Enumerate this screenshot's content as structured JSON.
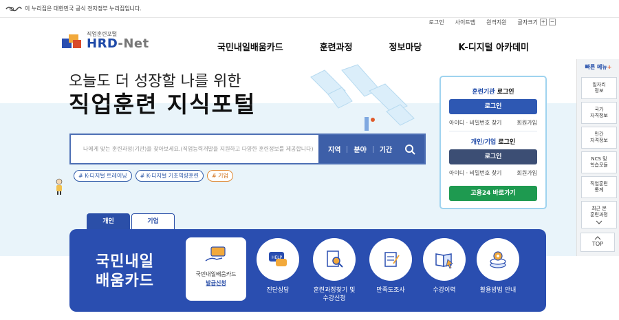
{
  "gov_bar": {
    "text": "이 누리집은 대한민국 공식 전자정부 누리집입니다."
  },
  "util": {
    "login": "로그인",
    "sitemap": "사이트맵",
    "remote": "원격지원",
    "fontsize": "글자크기",
    "plus": "+",
    "minus": "−"
  },
  "logo": {
    "sub": "직업훈련포털",
    "main_a": "HRD",
    "main_b": "-Net"
  },
  "gnb": [
    "국민내일배움카드",
    "훈련과정",
    "정보마당",
    "K-디지털 아카데미"
  ],
  "hero": {
    "line1": "오늘도 더 성장할 나를 위한",
    "line2": "직업훈련 지식포털"
  },
  "search": {
    "placeholder": "나에게 맞는 훈련과정(기관)을 찾아보세요.(직업능력개발을 지원하고 다양한 훈련정보를 제공합니다)",
    "filters": [
      "지역",
      "분야",
      "기간"
    ]
  },
  "tags": [
    "# K-디지털 트레이닝",
    "# K-디지털 기초역량훈련",
    "# 기업"
  ],
  "login": {
    "inst_title_a": "훈련기관",
    "inst_title_b": " 로그인",
    "inst_button": "로그인",
    "inst_find": "아이디 · 비밀번호 찾기",
    "inst_join": "회원가입",
    "user_title_a": "개인/기업",
    "user_title_b": " 로그인",
    "user_button": "로그인",
    "user_find": "아이디 · 비밀번호 찾기",
    "user_join": "회원가입",
    "goyong24": "고용24 바로가기"
  },
  "quick": {
    "title": "빠른 메뉴",
    "plus": "+",
    "items": [
      "일자리\n정보",
      "국가\n자격정보",
      "민간\n자격정보",
      "NCS 및\n학습모듈",
      "직업훈련\n통계",
      "최근 본\n훈련과정"
    ],
    "top": "TOP"
  },
  "tabs": [
    "개인",
    "기업"
  ],
  "card": {
    "big": "국민내일\n배움카드",
    "first_l1": "국민내일배움카드",
    "first_l2": "발급신청",
    "items": [
      "진단상담",
      "훈련과정찾기 및\n수강신청",
      "만족도조사",
      "수강이력",
      "활용방법 안내"
    ]
  },
  "colors": {
    "primary": "#2a4eb0",
    "green": "#1e9a50",
    "sky": "#e9f4fa",
    "orange": "#e08a36"
  }
}
